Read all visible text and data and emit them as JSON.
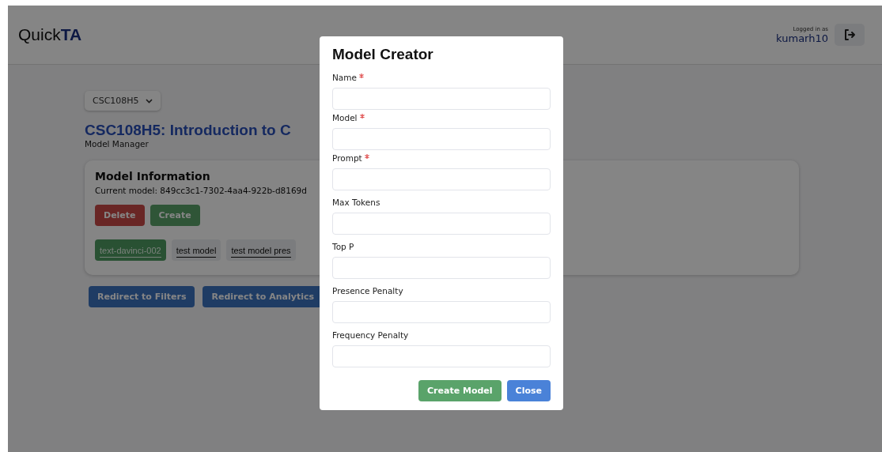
{
  "header": {
    "logo_regular": "Quick",
    "logo_bold": "TA",
    "login_label": "Logged in as",
    "username": "kumarh10"
  },
  "course_dropdown": {
    "value": "CSC108H5"
  },
  "page": {
    "title": "CSC108H5: Introduction to C",
    "subtitle": "Model Manager"
  },
  "model_card": {
    "title": "Model Information",
    "current_model": "Current model: 849cc3c1-7302-4aa4-922b-d8169d",
    "buttons": [
      {
        "label": "Delete",
        "kind": "danger"
      },
      {
        "label": "Create",
        "kind": "success"
      }
    ],
    "models": [
      {
        "label": "text-davinci-002",
        "selected": true
      },
      {
        "label": "test model",
        "selected": false
      },
      {
        "label": "test model pres",
        "selected": false
      }
    ]
  },
  "redirect_buttons": [
    "Redirect to Filters",
    "Redirect to Analytics"
  ],
  "modal": {
    "title": "Model Creator",
    "fields": [
      {
        "label": "Name",
        "required": true
      },
      {
        "label": "Model",
        "required": true
      },
      {
        "label": "Prompt",
        "required": true
      },
      {
        "label": "Max Tokens",
        "required": false
      },
      {
        "label": "Top P",
        "required": false
      },
      {
        "label": "Presence Penalty",
        "required": false
      },
      {
        "label": "Frequency Penalty",
        "required": false
      }
    ],
    "buttons": [
      {
        "label": "Create Model",
        "kind": "success"
      },
      {
        "label": "Close",
        "kind": "primary"
      }
    ]
  }
}
